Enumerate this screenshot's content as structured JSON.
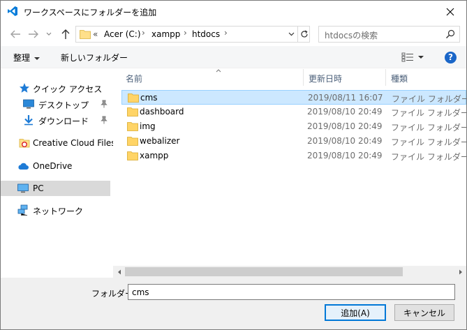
{
  "window": {
    "title": "ワークスペースにフォルダーを追加",
    "accent": "#0078d7"
  },
  "nav": {
    "back_icon": "arrow-left-icon",
    "forward_icon": "arrow-right-icon",
    "recent_icon": "chevron-down-icon",
    "up_icon": "arrow-up-icon",
    "breadcrumb": {
      "overflow": "«",
      "items": [
        "Acer (C:)",
        "xampp",
        "htdocs"
      ],
      "separator": "›"
    },
    "search_placeholder": "htdocsの検索"
  },
  "toolbar": {
    "organize": "整理",
    "new_folder": "新しいフォルダー",
    "help": "?"
  },
  "sidebar": {
    "items": [
      {
        "label": "クイック アクセス",
        "icon": "star-icon"
      },
      {
        "label": "デスクトップ",
        "icon": "desktop-icon"
      },
      {
        "label": "ダウンロード",
        "icon": "download-icon"
      },
      {
        "label": "Creative Cloud Files",
        "icon": "creative-cloud-icon"
      },
      {
        "label": "OneDrive",
        "icon": "cloud-icon"
      },
      {
        "label": "PC",
        "icon": "pc-icon"
      },
      {
        "label": "ネットワーク",
        "icon": "network-icon"
      }
    ]
  },
  "filelist": {
    "columns": [
      "名前",
      "更新日時",
      "種類"
    ],
    "rows": [
      {
        "name": "cms",
        "date": "2019/08/11 16:07",
        "type": "ファイル フォルダー"
      },
      {
        "name": "dashboard",
        "date": "2019/08/10 20:49",
        "type": "ファイル フォルダー"
      },
      {
        "name": "img",
        "date": "2019/08/10 20:49",
        "type": "ファイル フォルダー"
      },
      {
        "name": "webalizer",
        "date": "2019/08/10 20:49",
        "type": "ファイル フォルダー"
      },
      {
        "name": "xampp",
        "date": "2019/08/10 20:49",
        "type": "ファイル フォルダー"
      }
    ]
  },
  "bottom": {
    "folder_label": "フォルダー:",
    "folder_value": "cms",
    "add_button": "追加(A)",
    "cancel_button": "キャンセル"
  }
}
